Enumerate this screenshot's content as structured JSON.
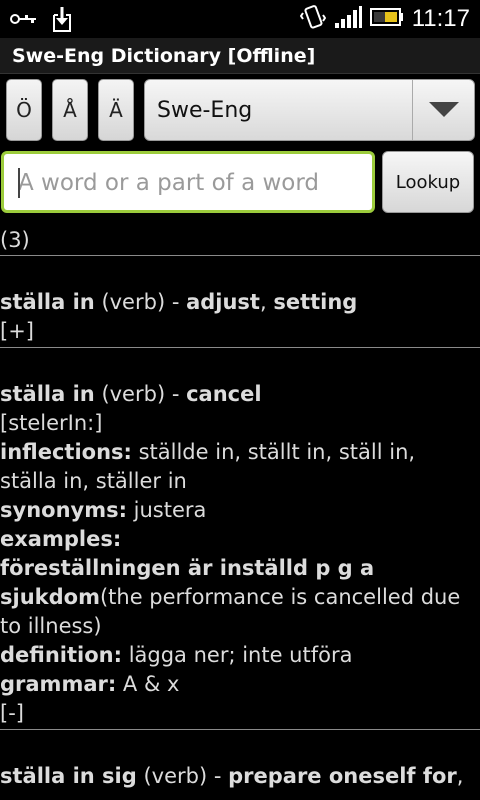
{
  "status_bar": {
    "time": "11:17",
    "icons": [
      "usb-icon",
      "download-icon",
      "vibrate-icon",
      "signal-icon",
      "battery-icon"
    ]
  },
  "title": "Swe-Eng Dictionary [Offline]",
  "char_buttons": [
    "Ö",
    "Å",
    "Ä"
  ],
  "language_select": {
    "value": "Swe-Eng"
  },
  "search": {
    "value": "",
    "placeholder": "A word or a part of a word"
  },
  "lookup_label": "Lookup",
  "results_count": "(3)",
  "entries": [
    {
      "word": "ställa in",
      "pos": "(verb)",
      "dash": " - ",
      "translation_a": "adjust",
      "comma": ", ",
      "translation_b": "setting",
      "toggle": "[+]"
    },
    {
      "word": "ställa in",
      "pos": "(verb)",
      "dash": " - ",
      "translation": "cancel",
      "pronunciation": "[stelerIn:]",
      "inflections_label": "inflections:",
      "inflections_1": " ställde in, ställt in, ställ in,",
      "inflections_2": "ställa in, ställer in",
      "synonyms_label": "synonyms:",
      "synonyms": " justera",
      "examples_label": "examples:",
      "example_sv_1": "föreställningen är inställd p g a",
      "example_sv_2": "sjukdom",
      "example_en_1": "(the performance is cancelled due",
      "example_en_2": "to illness)",
      "definition_label": "definition:",
      "definition": " lägga ner; inte utföra",
      "grammar_label": "grammar:",
      "grammar": " A & x",
      "toggle": "[-]"
    },
    {
      "word": "ställa in sig",
      "pos": "(verb)",
      "dash": " - ",
      "translation": "prepare oneself for",
      "trailing": ","
    }
  ],
  "colors": {
    "background": "#000000",
    "text": "#dcdcdc",
    "search_border": "#9ccc3c"
  }
}
